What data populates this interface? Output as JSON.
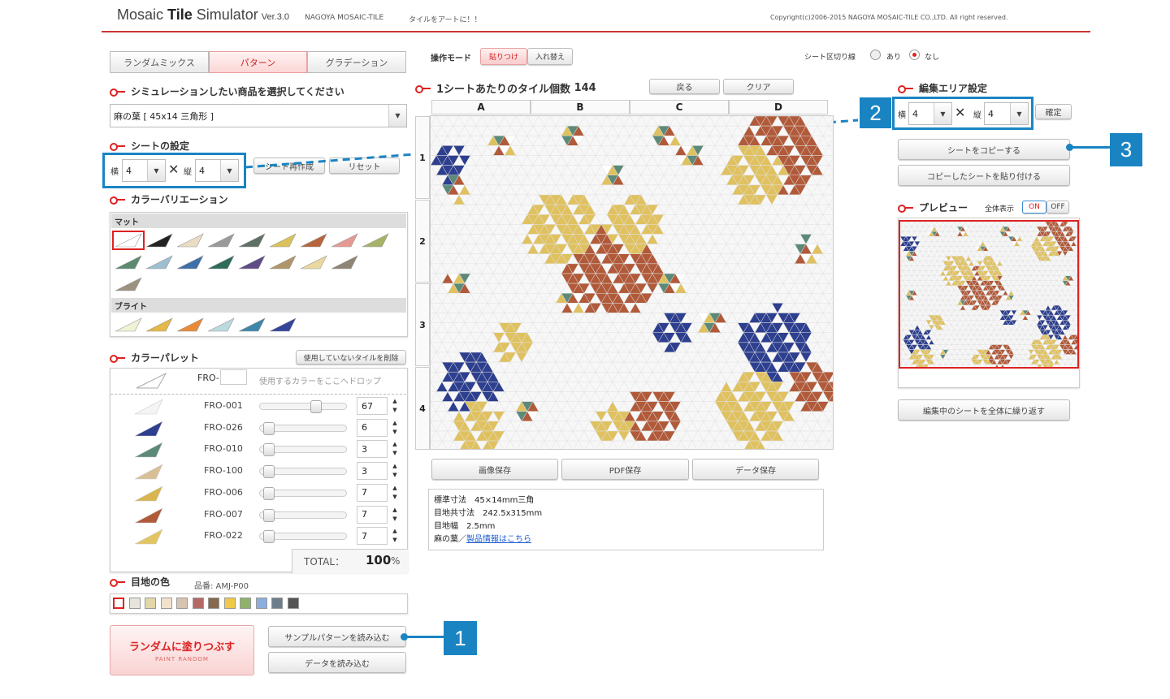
{
  "header": {
    "logo_text": "Mosaic",
    "logo_bold": "Tile",
    "logo_rest": "Simulator",
    "version": "Ver.3.0",
    "brand": "NAGOYA MOSAIC-TILE",
    "tagline": "タイルをアートに！！",
    "copyright": "Copyright(c)2006-2015 NAGOYA MOSAIC-TILE CO.,LTD. All right reserved."
  },
  "tabs": [
    {
      "label": "ランダムミックス"
    },
    {
      "label": "パターン"
    },
    {
      "label": "グラデーション"
    }
  ],
  "product": {
    "title": "シミュレーションしたい商品を選択してください",
    "selected": "麻の葉 [ 45x14 三角形 ]"
  },
  "sheet": {
    "title": "シートの設定",
    "yoko_label": "横",
    "yoko": "4",
    "tate_label": "縦",
    "tate": "4",
    "cross": "✕",
    "create_label": "シート再作成",
    "reset_label": "リセット"
  },
  "color_variation": {
    "title": "カラーバリエーション",
    "matte_label": "マット",
    "bright_label": "ブライト"
  },
  "palette": {
    "title": "カラーパレット",
    "delete_unused": "使用していないタイルを削除",
    "drop_code": "FRO-",
    "drop_hint": "使用するカラーをここへドロップ",
    "rows": [
      {
        "code": "FRO-001",
        "value": "67",
        "color": "#f4f4f4"
      },
      {
        "code": "FRO-026",
        "value": "6",
        "color": "#2d3f8e"
      },
      {
        "code": "FRO-010",
        "value": "3",
        "color": "#5d8a78"
      },
      {
        "code": "FRO-100",
        "value": "3",
        "color": "#d9bf96"
      },
      {
        "code": "FRO-006",
        "value": "7",
        "color": "#d8b54f"
      },
      {
        "code": "FRO-007",
        "value": "7",
        "color": "#b15a3a"
      },
      {
        "code": "FRO-022",
        "value": "7",
        "color": "#e2c463"
      }
    ],
    "total_label": "TOTAL：",
    "total_value": "100",
    "total_unit": "%"
  },
  "joint": {
    "title": "目地の色",
    "code_label": "品番: AMJ-P00"
  },
  "random_button": {
    "label": "ランダムに塗りつぶす",
    "sub": "PAINT RANDOM"
  },
  "load_sample_label": "サンプルパターンを読み込む",
  "load_data_label": "データを読み込む",
  "mode": {
    "label": "操作モード",
    "paste_label": "貼りつけ",
    "swap_label": "入れ替え"
  },
  "sheet_line": {
    "label": "シート区切り線",
    "on_label": "あり",
    "off_label": "なし"
  },
  "canvas": {
    "title": "1シートあたりのタイル個数",
    "count": "144",
    "undo_label": "戻る",
    "clear_label": "クリア",
    "cols": [
      "A",
      "B",
      "C",
      "D"
    ],
    "rows": [
      "1",
      "2",
      "3",
      "4"
    ]
  },
  "save": {
    "image_label": "画像保存",
    "pdf_label": "PDF保存",
    "data_label": "データ保存"
  },
  "info": {
    "line1": "標準寸法　45×14mm三角",
    "line2": "目地共寸法　242.5x315mm",
    "line3": "目地幅　2.5mm",
    "line4_prefix": "麻の葉／",
    "line4_link": "製品情報はこちら"
  },
  "edit_area": {
    "title": "編集エリア設定",
    "yoko_label": "横",
    "yoko": "4",
    "tate_label": "縦",
    "tate": "4",
    "cross": "✕",
    "confirm_label": "確定",
    "copy_label": "シートをコピーする",
    "paste_label": "コピーしたシートを貼り付ける"
  },
  "preview": {
    "title": "プレビュー",
    "full_label": "全体表示",
    "on_label": "ON",
    "off_label": "OFF"
  },
  "repeat_label": "編集中のシートを全体に繰り返す",
  "callouts": [
    "1",
    "2",
    "3"
  ],
  "colors": {
    "accent": "#dd2222",
    "callout": "#1a84c3",
    "brown": "#b15a3a",
    "yellow": "#e0c160",
    "navy": "#2d3f8e",
    "green": "#5d8a78"
  }
}
